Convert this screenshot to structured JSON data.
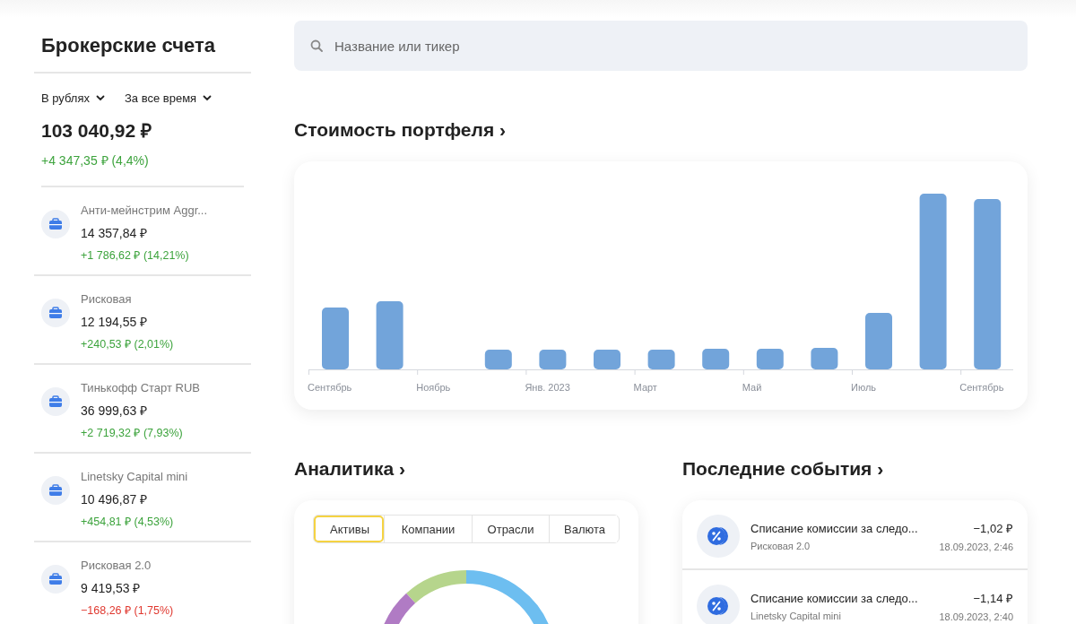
{
  "sidebar": {
    "title": "Брокерские счета",
    "filters": [
      {
        "label": "В рублях"
      },
      {
        "label": "За все время"
      }
    ],
    "total": "103 040,92 ₽",
    "total_change": "+4 347,35 ₽ (4,4%)",
    "total_negative": false,
    "accounts": [
      {
        "name": "Анти-мейнстрим Aggr...",
        "value": "14 357,84 ₽",
        "change": "+1 786,62 ₽ (14,21%)",
        "negative": false
      },
      {
        "name": "Рисковая",
        "value": "12 194,55 ₽",
        "change": "+240,53 ₽ (2,01%)",
        "negative": false
      },
      {
        "name": "Тинькофф Старт RUB",
        "value": "36 999,63 ₽",
        "change": "+2 719,32 ₽ (7,93%)",
        "negative": false
      },
      {
        "name": "Linetsky Capital mini",
        "value": "10 496,87 ₽",
        "change": "+454,81 ₽ (4,53%)",
        "negative": false
      },
      {
        "name": "Рисковая 2.0",
        "value": "9 419,53 ₽",
        "change": "−168,26 ₽ (1,75%)",
        "negative": true
      }
    ]
  },
  "search": {
    "placeholder": "Название или тикер"
  },
  "portfolio": {
    "title": "Стоимость портфеля ›",
    "x_labels": [
      "Сентябрь",
      "Ноябрь",
      "Янв. 2023",
      "Март",
      "Май",
      "Июль",
      "Сентябрь"
    ]
  },
  "analytics": {
    "title": "Аналитика ›",
    "tabs": [
      {
        "label": "Активы",
        "selected": true
      },
      {
        "label": "Компании",
        "selected": false
      },
      {
        "label": "Отрасли",
        "selected": false
      },
      {
        "label": "Валюта",
        "selected": false
      }
    ]
  },
  "events": {
    "title": "Последние события ›",
    "items": [
      {
        "title": "Списание комиссии за следо...",
        "account": "Рисковая 2.0",
        "amount": "−1,02 ₽",
        "time": "18.09.2023, 2:46"
      },
      {
        "title": "Списание комиссии за следо...",
        "account": "Linetsky Capital mini",
        "amount": "−1,14 ₽",
        "time": "18.09.2023, 2:40"
      }
    ]
  }
}
